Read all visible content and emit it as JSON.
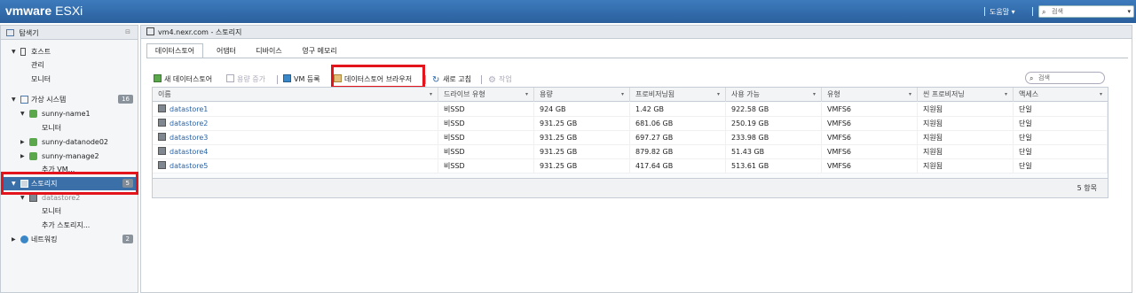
{
  "header": {
    "logo_vm": "vmware",
    "logo_product": "ESXi",
    "help_label": "도움말 ▾",
    "search_placeholder": "검색"
  },
  "sidebar": {
    "title": "탐색기",
    "items": [
      {
        "label": "호스트"
      },
      {
        "label": "관리"
      },
      {
        "label": "모니터"
      },
      {
        "label": "가상 시스템",
        "badge": "16"
      },
      {
        "label": "sunny-name1"
      },
      {
        "label": "모니터"
      },
      {
        "label": "sunny-datanode02"
      },
      {
        "label": "sunny-manage2"
      },
      {
        "label": "추가 VM..."
      },
      {
        "label": "스토리지",
        "badge": "5"
      },
      {
        "label": "datastore2"
      },
      {
        "label": "모니터"
      },
      {
        "label": "추가 스토리지..."
      },
      {
        "label": "네트워킹",
        "badge": "2"
      }
    ]
  },
  "main": {
    "title": "vm4.nexr.com - 스토리지",
    "tabs": [
      "데이터스토어",
      "어댑터",
      "디바이스",
      "영구 메모리"
    ],
    "toolbar": {
      "new_datastore": "새 데이터스토어",
      "increase_capacity": "용량 증가",
      "register_vm": "VM 등록",
      "datastore_browser": "데이터스토어 브라우저",
      "refresh": "새로 고침",
      "actions": "작업"
    },
    "search_placeholder": "검색",
    "columns": [
      "이름",
      "드라이브 유형",
      "용량",
      "프로비저닝됨",
      "사용 가능",
      "유형",
      "씬 프로비저닝",
      "액세스"
    ],
    "rows": [
      [
        "datastore1",
        "비SSD",
        "924 GB",
        "1.42 GB",
        "922.58 GB",
        "VMFS6",
        "지원됨",
        "단일"
      ],
      [
        "datastore2",
        "비SSD",
        "931.25 GB",
        "681.06 GB",
        "250.19 GB",
        "VMFS6",
        "지원됨",
        "단일"
      ],
      [
        "datastore3",
        "비SSD",
        "931.25 GB",
        "697.27 GB",
        "233.98 GB",
        "VMFS6",
        "지원됨",
        "단일"
      ],
      [
        "datastore4",
        "비SSD",
        "931.25 GB",
        "879.82 GB",
        "51.43 GB",
        "VMFS6",
        "지원됨",
        "단일"
      ],
      [
        "datastore5",
        "비SSD",
        "931.25 GB",
        "417.64 GB",
        "513.61 GB",
        "VMFS6",
        "지원됨",
        "단일"
      ]
    ],
    "footer_count": "5 항목"
  }
}
